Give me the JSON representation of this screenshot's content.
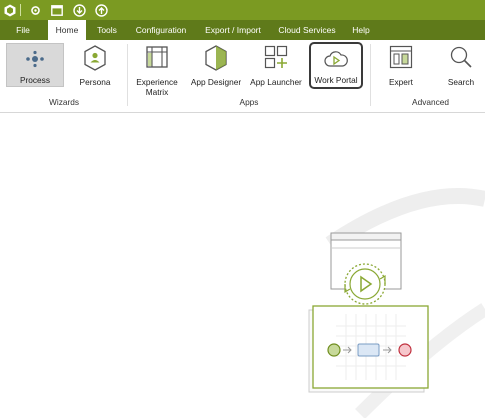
{
  "menu": {
    "tabs": [
      {
        "label": "File"
      },
      {
        "label": "Home"
      },
      {
        "label": "Tools"
      },
      {
        "label": "Configuration"
      },
      {
        "label": "Export / Import"
      },
      {
        "label": "Cloud Services"
      },
      {
        "label": "Help"
      }
    ]
  },
  "ribbon": {
    "wizards": {
      "label": "Wizards",
      "process": "Process",
      "persona": "Persona"
    },
    "apps": {
      "label": "Apps",
      "experience_matrix_line1": "Experience",
      "experience_matrix_line2": "Matrix",
      "app_designer": "App Designer",
      "app_launcher": "App Launcher",
      "work_portal": "Work Portal"
    },
    "advanced": {
      "label": "Advanced",
      "expert": "Expert",
      "search": "Search"
    }
  },
  "colors": {
    "titlebar": "#7b9a22",
    "tabbar": "#5f7a1a",
    "accent_green": "#8aa834",
    "selected_button_bg": "#d9d9d9"
  }
}
